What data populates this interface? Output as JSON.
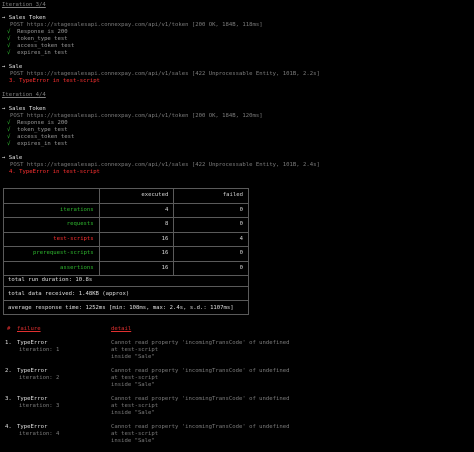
{
  "iterations": [
    {
      "title": "Iteration 3/4",
      "requests": [
        {
          "name": "Sales Token",
          "line": "POST https://stagesalesapi.connexpay.com/api/v1/token [200 OK, 184B, 118ms]",
          "assertions": [
            "Response is 200",
            "token_type test",
            "access_token test",
            "expires_in test"
          ]
        },
        {
          "name": "Sale",
          "line": "POST https://stagesalesapi.connexpay.com/api/v1/sales [422 Unprocessable Entity, 101B, 2.2s]",
          "error": "3. TypeError in test-script"
        }
      ]
    },
    {
      "title": "Iteration 4/4",
      "requests": [
        {
          "name": "Sales Token",
          "line": "POST https://stagesalesapi.connexpay.com/api/v1/token [200 OK, 184B, 120ms]",
          "assertions": [
            "Response is 200",
            "token_type test",
            "access_token test",
            "expires_in test"
          ]
        },
        {
          "name": "Sale",
          "line": "POST https://stagesalesapi.connexpay.com/api/v1/sales [422 Unprocessable Entity, 101B, 2.4s]",
          "error": "4. TypeError in test-script"
        }
      ]
    }
  ],
  "summary": {
    "col_executed": "executed",
    "col_failed": "failed",
    "rows": [
      {
        "label": "iterations",
        "executed": "4",
        "failed": "0",
        "status": "ok"
      },
      {
        "label": "requests",
        "executed": "8",
        "failed": "0",
        "status": "ok"
      },
      {
        "label": "test-scripts",
        "executed": "16",
        "failed": "4",
        "status": "fail"
      },
      {
        "label": "prerequest-scripts",
        "executed": "16",
        "failed": "0",
        "status": "ok"
      },
      {
        "label": "assertions",
        "executed": "16",
        "failed": "0",
        "status": "ok"
      }
    ],
    "run_duration": "total run duration: 10.8s",
    "data_received": "total data received: 1.48KB (approx)",
    "avg_response": "average response time: 1252ms [min: 108ms, max: 2.4s, s.d.: 1107ms]"
  },
  "failures": {
    "hdr_num": "#",
    "hdr_failure": "failure",
    "hdr_detail": "detail",
    "items": [
      {
        "num": "1.",
        "type": "TypeError",
        "iteration": "iteration: 1",
        "detail": [
          "Cannot read property 'incomingTransCode' of undefined",
          "at test-script",
          "inside \"Sale\""
        ]
      },
      {
        "num": "2.",
        "type": "TypeError",
        "iteration": "iteration: 2",
        "detail": [
          "Cannot read property 'incomingTransCode' of undefined",
          "at test-script",
          "inside \"Sale\""
        ]
      },
      {
        "num": "3.",
        "type": "TypeError",
        "iteration": "iteration: 3",
        "detail": [
          "Cannot read property 'incomingTransCode' of undefined",
          "at test-script",
          "inside \"Sale\""
        ]
      },
      {
        "num": "4.",
        "type": "TypeError",
        "iteration": "iteration: 4",
        "detail": [
          "Cannot read property 'incomingTransCode' of undefined",
          "at test-script",
          "inside \"Sale\""
        ]
      }
    ]
  },
  "glyphs": {
    "arrow": "→",
    "check": "√"
  },
  "colors": {
    "pass": "#2fb82f",
    "fail": "#ff3030",
    "text": "#d0d0d0",
    "dim": "#7d7d7d",
    "background": "#000000"
  }
}
